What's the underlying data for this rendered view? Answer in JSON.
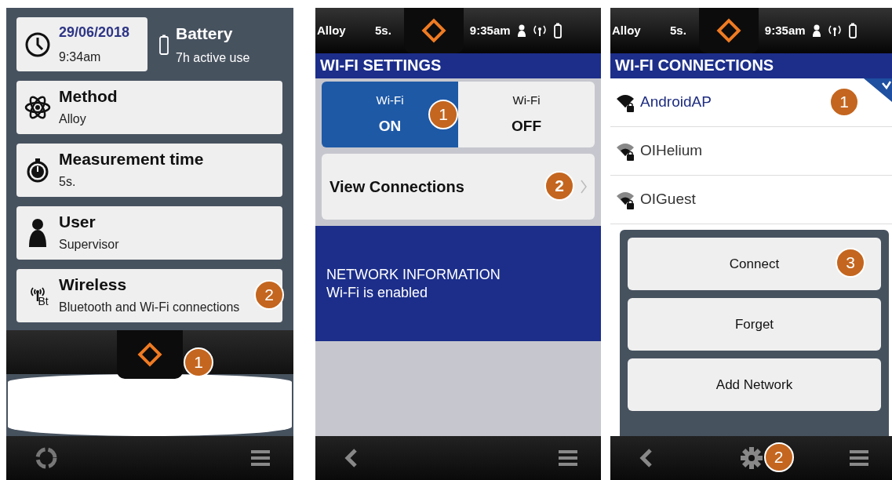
{
  "home_screen": {
    "clock": {
      "date": "29/06/2018",
      "time": "9:34am"
    },
    "battery": {
      "title": "Battery",
      "detail": "7h active use"
    },
    "settings": [
      {
        "kind": "method",
        "title": "Method",
        "value": "Alloy"
      },
      {
        "kind": "timer",
        "title": "Measurement time",
        "value": "5s."
      },
      {
        "kind": "user",
        "title": "User",
        "value": "Supervisor"
      },
      {
        "kind": "wireless",
        "icon_text": "Bt",
        "title": "Wireless",
        "value": "Bluetooth and Wi-Fi connections",
        "callout": "2"
      }
    ],
    "home_callout": "1"
  },
  "wifi_settings_screen": {
    "status_bar": {
      "method": "Alloy",
      "duration": "5s.",
      "clock": "9:35am"
    },
    "title": "WI-FI SETTINGS",
    "toggle": [
      {
        "label": "Wi-Fi",
        "state": "ON",
        "selected": true,
        "callout": "1"
      },
      {
        "label": "Wi-Fi",
        "state": "OFF",
        "selected": false
      }
    ],
    "view_connections": {
      "label": "View Connections",
      "callout": "2"
    },
    "network_info": {
      "heading": "NETWORK INFORMATION",
      "text": "Wi-Fi is enabled"
    }
  },
  "wifi_connections_screen": {
    "status_bar": {
      "method": "Alloy",
      "duration": "5s.",
      "clock": "9:35am"
    },
    "title": "WI-FI CONNECTIONS",
    "networks": [
      {
        "name": "AndroidAP",
        "selected": true,
        "callout": "1"
      },
      {
        "name": "OIHelium",
        "selected": false
      },
      {
        "name": "OIGuest",
        "selected": false
      }
    ],
    "actions": [
      {
        "label": "Connect",
        "callout": "3"
      },
      {
        "label": "Forget"
      },
      {
        "label": "Add Network"
      }
    ],
    "settings_callout": "2"
  }
}
